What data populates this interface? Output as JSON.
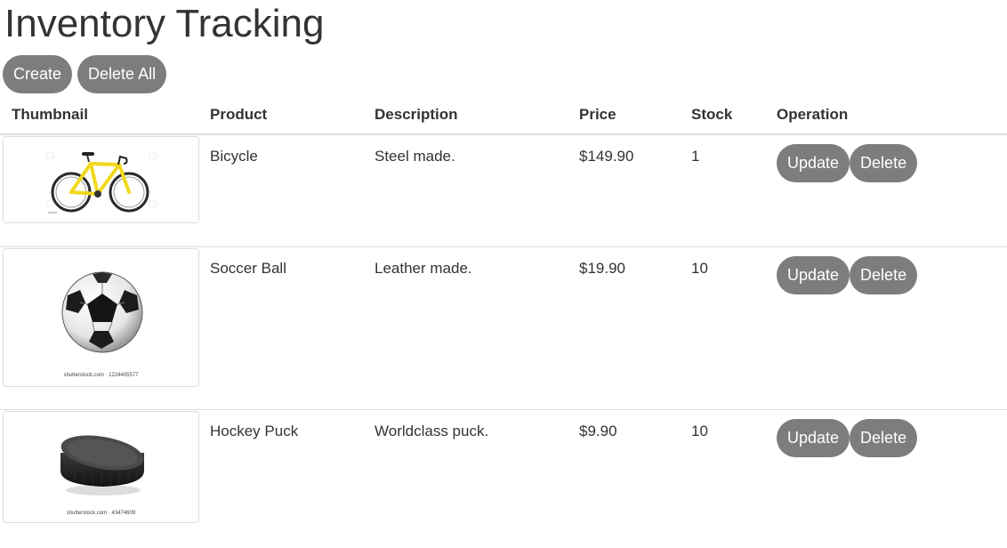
{
  "page": {
    "title": "Inventory Tracking"
  },
  "toolbar": {
    "create_label": "Create",
    "delete_all_label": "Delete All"
  },
  "table": {
    "headers": {
      "thumbnail": "Thumbnail",
      "product": "Product",
      "description": "Description",
      "price": "Price",
      "stock": "Stock",
      "operation": "Operation"
    },
    "rows": [
      {
        "thumbnail_icon": "bicycle-image",
        "product": "Bicycle",
        "description": "Steel made.",
        "price": "$149.90",
        "stock": "1",
        "update_label": "Update",
        "delete_label": "Delete"
      },
      {
        "thumbnail_icon": "soccer-ball-image",
        "thumbnail_caption": "shutterstock.com · 1224405577",
        "product": "Soccer Ball",
        "description": "Leather made.",
        "price": "$19.90",
        "stock": "10",
        "update_label": "Update",
        "delete_label": "Delete"
      },
      {
        "thumbnail_icon": "hockey-puck-image",
        "thumbnail_caption": "shutterstock.com · 43474609",
        "product": "Hockey Puck",
        "description": "Worldclass puck.",
        "price": "$9.90",
        "stock": "10",
        "update_label": "Update",
        "delete_label": "Delete"
      }
    ]
  },
  "colors": {
    "button_bg": "#7d7d7d",
    "button_text": "#ffffff",
    "text": "#333333",
    "border": "#dddddd",
    "bicycle_frame": "#f2d81b"
  }
}
